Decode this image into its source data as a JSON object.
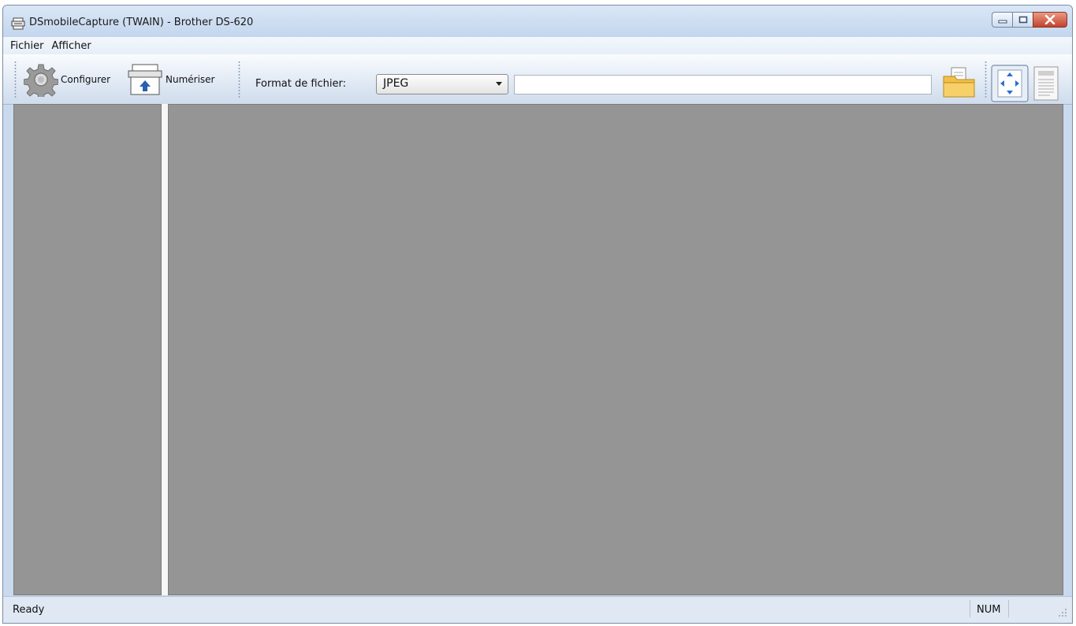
{
  "window": {
    "title": "DSmobileCapture (TWAIN) - Brother DS-620"
  },
  "menu": {
    "items": [
      {
        "label": "Fichier"
      },
      {
        "label": "Afficher"
      }
    ]
  },
  "toolbar": {
    "configure_label": "Configurer",
    "scan_label": "Numériser",
    "format_label": "Format de fichier:",
    "format_value": "JPEG",
    "path_value": ""
  },
  "status": {
    "text": "Ready",
    "num": "NUM"
  },
  "icons": {
    "title": "scanner-icon",
    "configure": "gear-icon",
    "scan": "scanner-upload-icon",
    "browse": "open-folder-icon",
    "fit": "fit-to-window-icon",
    "page": "page-view-icon"
  },
  "colors": {
    "panel_background": "#959595",
    "close_button": "#c4432b"
  }
}
